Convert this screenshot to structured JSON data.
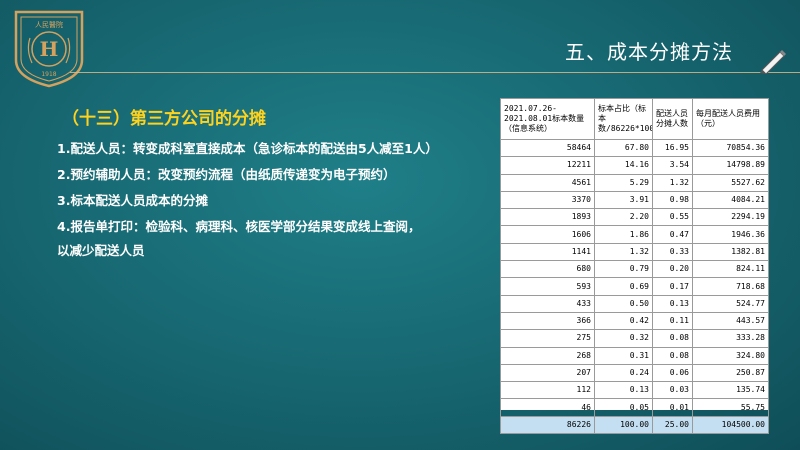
{
  "logo": {
    "top_text": "人民醫院",
    "year": "1918"
  },
  "header": {
    "title": "五、成本分摊方法"
  },
  "section": {
    "title": "（十三）第三方公司的分摊"
  },
  "items": [
    "1.配送人员：转变成科室直接成本（急诊标本的配送由5人减至1人）",
    "2.预约辅助人员：改变预约流程（由纸质传递变为电子预约）",
    "3.标本配送人员成本的分摊",
    "4.报告单打印：检验科、病理科、核医学部分结果变成线上查阅，",
    "以减少配送人员"
  ],
  "table": {
    "headers": [
      "2021.07.26-2021.08.01标本数量（信息系统）",
      "标本占比（标本数/86226*100",
      "配送人员分摊人数",
      "每月配送人员费用（元）"
    ],
    "rows": [
      [
        "58464",
        "67.80",
        "16.95",
        "70854.36"
      ],
      [
        "12211",
        "14.16",
        "3.54",
        "14798.89"
      ],
      [
        "4561",
        "5.29",
        "1.32",
        "5527.62"
      ],
      [
        "3370",
        "3.91",
        "0.98",
        "4084.21"
      ],
      [
        "1893",
        "2.20",
        "0.55",
        "2294.19"
      ],
      [
        "1606",
        "1.86",
        "0.47",
        "1946.36"
      ],
      [
        "1141",
        "1.32",
        "0.33",
        "1382.81"
      ],
      [
        "680",
        "0.79",
        "0.20",
        "824.11"
      ],
      [
        "593",
        "0.69",
        "0.17",
        "718.68"
      ],
      [
        "433",
        "0.50",
        "0.13",
        "524.77"
      ],
      [
        "366",
        "0.42",
        "0.11",
        "443.57"
      ],
      [
        "275",
        "0.32",
        "0.08",
        "333.28"
      ],
      [
        "268",
        "0.31",
        "0.08",
        "324.80"
      ],
      [
        "207",
        "0.24",
        "0.06",
        "250.87"
      ],
      [
        "112",
        "0.13",
        "0.03",
        "135.74"
      ],
      [
        "46",
        "0.05",
        "0.01",
        "55.75"
      ]
    ],
    "total": [
      "86226",
      "100.00",
      "25.00",
      "104500.00"
    ]
  },
  "colors": {
    "accent_yellow": "#ffd21e",
    "gold_line": "#d8b98a",
    "bg_teal": "#16656f",
    "total_row": "#c5dff2"
  },
  "icons": {
    "logo": "hospital-emblem-icon",
    "pen": "pen-icon"
  }
}
